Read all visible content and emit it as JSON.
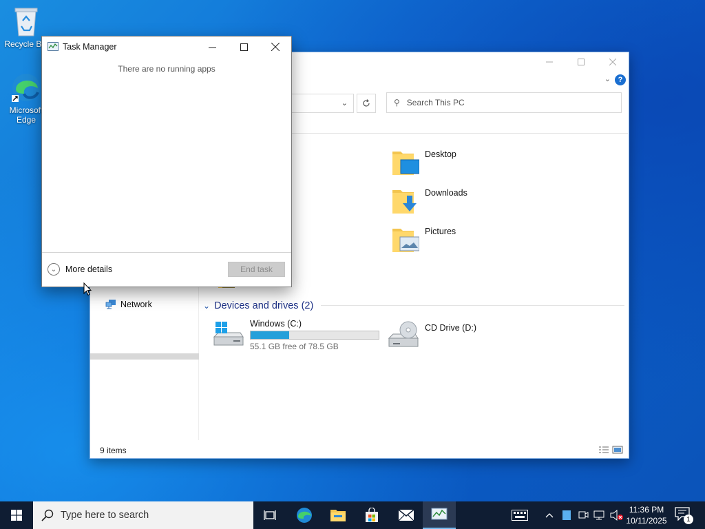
{
  "desktop": {
    "icons": [
      {
        "label": "Recycle Bin",
        "icon": "recycle-bin-icon"
      },
      {
        "label": "Microsoft Edge",
        "icon": "edge-icon"
      }
    ]
  },
  "explorer": {
    "search_placeholder": "Search This PC",
    "help_label": "?",
    "folders": [
      {
        "label": "Desktop",
        "icon": "desktop-folder-icon"
      },
      {
        "label": "Downloads",
        "icon": "downloads-folder-icon"
      },
      {
        "label": "Pictures",
        "icon": "pictures-folder-icon"
      }
    ],
    "nav": {
      "network_label": "Network"
    },
    "devices_section": "Devices and drives (2)",
    "drives": [
      {
        "name": "Windows (C:)",
        "free_text": "55.1 GB free of 78.5 GB",
        "used_fraction": 0.3,
        "icon": "windows-drive-icon"
      },
      {
        "name": "CD Drive (D:)",
        "icon": "cd-drive-icon"
      }
    ],
    "status": "9 items"
  },
  "taskmanager": {
    "title": "Task Manager",
    "empty_message": "There are no running apps",
    "more_details": "More details",
    "end_task": "End task"
  },
  "taskbar": {
    "search_placeholder": "Type here to search",
    "clock_time": "11:36 PM",
    "clock_date": "10/11/2025",
    "notification_count": "1",
    "colors": {
      "bar": "#0f1d33",
      "accent": "#76b9ed"
    }
  }
}
